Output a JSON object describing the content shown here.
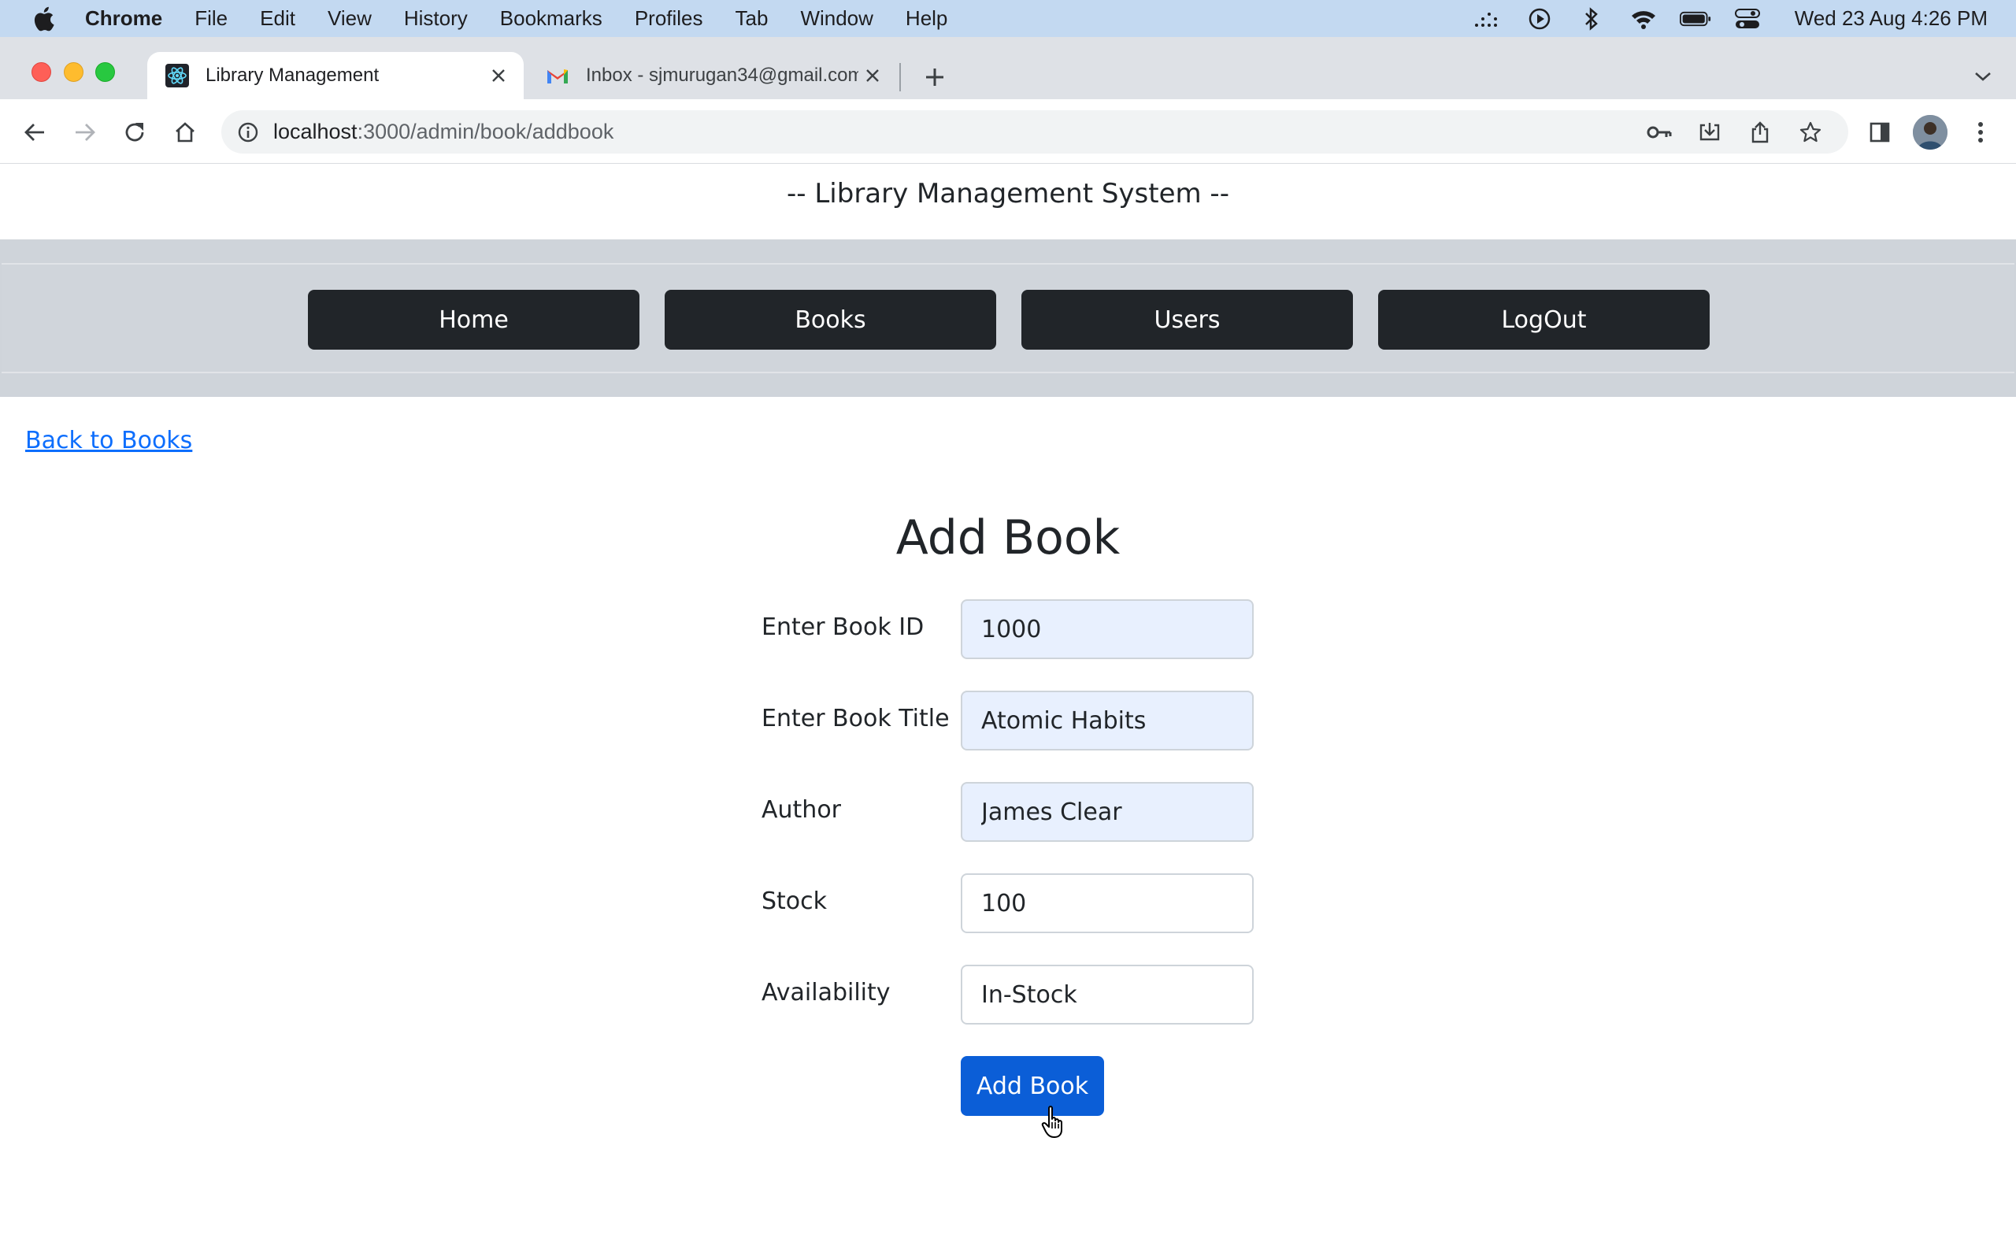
{
  "menubar": {
    "app_name": "Chrome",
    "items": [
      "File",
      "Edit",
      "View",
      "History",
      "Bookmarks",
      "Profiles",
      "Tab",
      "Window",
      "Help"
    ],
    "clock": "Wed 23 Aug  4:26 PM",
    "status_icons": [
      "dotted-menu-icon",
      "play-circle-icon",
      "bluetooth-icon",
      "wifi-icon",
      "battery-icon",
      "control-center-icon"
    ]
  },
  "browser": {
    "tabs": [
      {
        "title": "Library Management",
        "icon": "react-icon",
        "active": true
      },
      {
        "title": "Inbox - sjmurugan34@gmail.com",
        "icon": "gmail-icon",
        "active": false
      }
    ],
    "url_host": "localhost",
    "url_path": ":3000/admin/book/addbook"
  },
  "page": {
    "site_title": "-- Library Management System --",
    "nav": [
      {
        "label": "Home"
      },
      {
        "label": "Books"
      },
      {
        "label": "Users"
      },
      {
        "label": "LogOut"
      }
    ],
    "back_link": "Back to Books",
    "form": {
      "title": "Add Book",
      "fields": [
        {
          "label": "Enter Book ID",
          "value": "1000",
          "autofilled": true
        },
        {
          "label": "Enter Book Title",
          "value": "Atomic Habits",
          "autofilled": true
        },
        {
          "label": "Author",
          "value": "James Clear",
          "autofilled": true
        },
        {
          "label": "Stock",
          "value": "100",
          "autofilled": false
        },
        {
          "label": "Availability",
          "value": "In-Stock",
          "autofilled": false
        }
      ],
      "submit_label": "Add Book"
    }
  },
  "colors": {
    "nav_button": "#212529",
    "primary": "#0b5ed7",
    "link": "#0d6efd",
    "autofill_bg": "#e8f0fe",
    "nav_band": "#cfd4da"
  }
}
